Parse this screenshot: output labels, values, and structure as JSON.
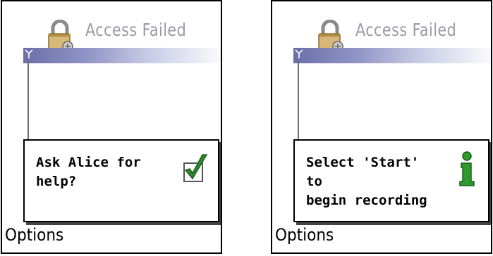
{
  "screens": [
    {
      "title": "Access Failed",
      "dialog_text": "Ask Alice for\nhelp?",
      "dialog_icon": "check-icon",
      "softkey": "Options"
    },
    {
      "title": "Access Failed",
      "dialog_text": "Select 'Start' to\nbegin recording",
      "dialog_icon": "info-icon",
      "softkey": "Options"
    }
  ],
  "colors": {
    "title_text": "#9a9aa8",
    "title_bar": "#6c6fa8",
    "check_green": "#2e8a2e",
    "info_green": "#2e9a2e"
  }
}
